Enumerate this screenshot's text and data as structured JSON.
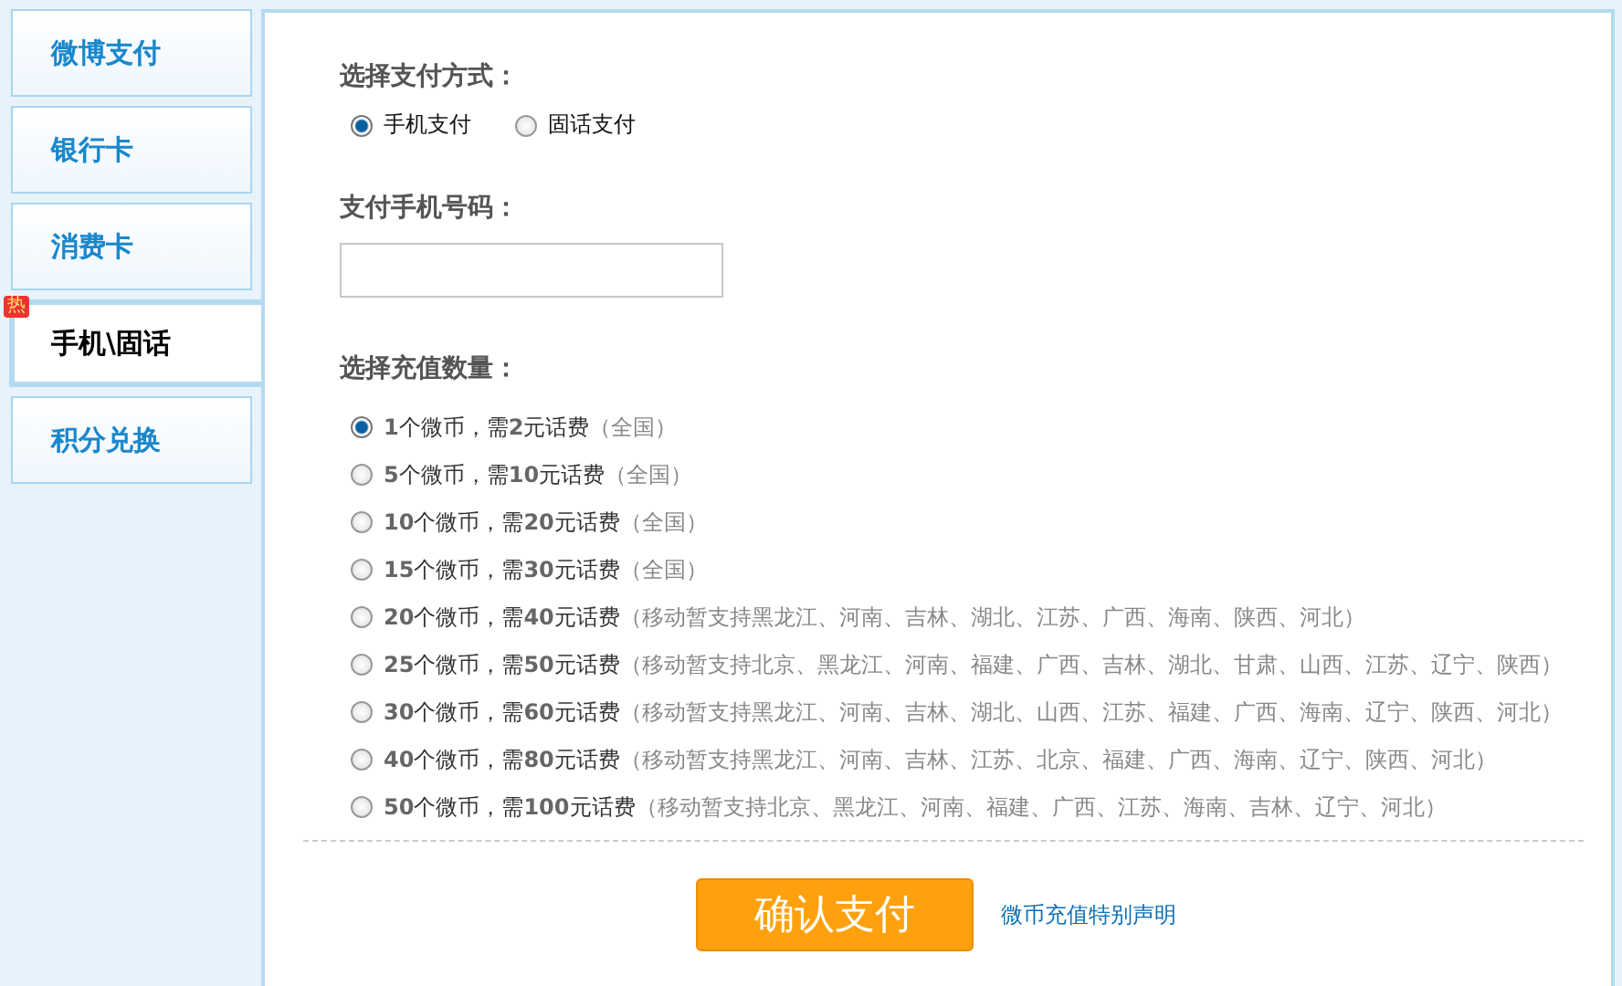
{
  "sidebar": {
    "items": [
      {
        "label": "微博支付",
        "selected": false
      },
      {
        "label": "银行卡",
        "selected": false
      },
      {
        "label": "消费卡",
        "selected": false
      },
      {
        "label": "手机\\固话",
        "selected": true,
        "badge": "热"
      },
      {
        "label": "积分兑换",
        "selected": false
      }
    ]
  },
  "payment_method": {
    "label": "选择支付方式：",
    "options": [
      {
        "label": "手机支付",
        "selected": true
      },
      {
        "label": "固话支付",
        "selected": false
      }
    ]
  },
  "phone_number": {
    "label": "支付手机号码："
  },
  "amount": {
    "label": "选择充值数量：",
    "options": [
      {
        "label": "**1**个微币，需**2**元话费",
        "note": "（全国）",
        "selected": true
      },
      {
        "label": "**5**个微币，需**10**元话费",
        "note": "（全国）",
        "selected": false
      },
      {
        "label": "**10**个微币，需**20**元话费",
        "note": "（全国）",
        "selected": false
      },
      {
        "label": "**15**个微币，需**30**元话费",
        "note": "（全国）",
        "selected": false
      },
      {
        "label": "**20**个微币，需**40**元话费",
        "note": "（移动暂支持黑龙江、河南、吉林、湖北、江苏、广西、海南、陕西、河北）",
        "selected": false
      },
      {
        "label": "**25**个微币，需**50**元话费",
        "note": "（移动暂支持北京、黑龙江、河南、福建、广西、吉林、湖北、甘肃、山西、江苏、辽宁、陕西）",
        "selected": false
      },
      {
        "label": "**30**个微币，需**60**元话费",
        "note": "（移动暂支持黑龙江、河南、吉林、湖北、山西、江苏、福建、广西、海南、辽宁、陕西、河北）",
        "selected": false
      },
      {
        "label": "**40**个微币，需**80**元话费",
        "note": "（移动暂支持黑龙江、河南、吉林、江苏、北京、福建、广西、海南、辽宁、陕西、河北）",
        "selected": false
      },
      {
        "label": "**50**个微币，需**100**元话费",
        "note": "（移动暂支持北京、黑龙江、河南、福建、广西、江苏、海南、吉林、辽宁、河北）",
        "selected": false
      }
    ]
  },
  "confirm_button": "确认支付",
  "notice_link": "微币充值特别声明"
}
